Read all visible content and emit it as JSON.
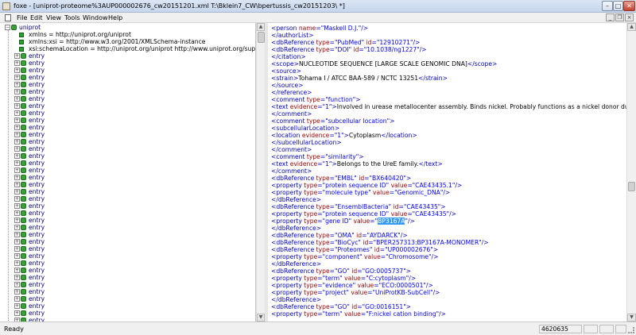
{
  "window": {
    "title": "foxe - [uniprot-proteome%3AUP000002676_cw20151201.xml  T:\\Bklein7_CW\\bpertussis_cw20151203\\ *]",
    "buttons": {
      "minimize": "–",
      "maximize": "□",
      "close": "✕"
    }
  },
  "menu": {
    "items": [
      "File",
      "Edit",
      "View",
      "Tools",
      "Window",
      "Help"
    ],
    "mdi": {
      "minimize": "_",
      "restore": "❐",
      "close": "×"
    }
  },
  "tree": {
    "root": "uniprot",
    "attributes": [
      "xmlns = http://uniprot.org/uniprot",
      "xmlns:xsi = http://www.w3.org/2001/XMLSchema-instance",
      "xsi:schemaLocation = http://uniprot.org/uniprot http://www.uniprot.org/suppor"
    ],
    "entry_label": "entry",
    "entry_count": 40
  },
  "xml_lines": [
    [
      [
        "t",
        "<person "
      ],
      [
        "a",
        "name"
      ],
      [
        "t",
        "=\""
      ],
      [
        "v",
        "Maskell D.J."
      ],
      [
        "t",
        "\"/>"
      ]
    ],
    [
      [
        "t",
        "</authorList>"
      ]
    ],
    [
      [
        "t",
        "<dbReference "
      ],
      [
        "a",
        "type"
      ],
      [
        "t",
        "=\""
      ],
      [
        "v",
        "PubMed"
      ],
      [
        "t",
        "\" "
      ],
      [
        "a",
        "id"
      ],
      [
        "t",
        "=\""
      ],
      [
        "v",
        "12910271"
      ],
      [
        "t",
        "\"/>"
      ]
    ],
    [
      [
        "t",
        "<dbReference "
      ],
      [
        "a",
        "type"
      ],
      [
        "t",
        "=\""
      ],
      [
        "v",
        "DOI"
      ],
      [
        "t",
        "\" "
      ],
      [
        "a",
        "id"
      ],
      [
        "t",
        "=\""
      ],
      [
        "v",
        "10.1038/ng1227"
      ],
      [
        "t",
        "\"/>"
      ]
    ],
    [
      [
        "t",
        "</citation>"
      ]
    ],
    [
      [
        "t",
        "<scope>"
      ],
      [
        "tx",
        "NUCLEOTIDE SEQUENCE [LARGE SCALE GENOMIC DNA]"
      ],
      [
        "t",
        "</scope>"
      ]
    ],
    [
      [
        "t",
        "<source>"
      ]
    ],
    [
      [
        "t",
        "<strain>"
      ],
      [
        "tx",
        "Tohama I / ATCC BAA-589 / NCTC 13251"
      ],
      [
        "t",
        "</strain>"
      ]
    ],
    [
      [
        "t",
        "</source>"
      ]
    ],
    [
      [
        "t",
        "</reference>"
      ]
    ],
    [
      [
        "t",
        "<comment "
      ],
      [
        "a",
        "type"
      ],
      [
        "t",
        "=\""
      ],
      [
        "v",
        "function"
      ],
      [
        "t",
        "\">"
      ]
    ],
    [
      [
        "t",
        "<text "
      ],
      [
        "a",
        "evidence"
      ],
      [
        "t",
        "=\""
      ],
      [
        "v",
        "1"
      ],
      [
        "t",
        "\">"
      ],
      [
        "tx",
        "Involved in urease metallocenter assembly. Binds nickel. Probably functions as a nickel donor during metal"
      ]
    ],
    [
      [
        "t",
        "</comment>"
      ]
    ],
    [
      [
        "t",
        "<comment "
      ],
      [
        "a",
        "type"
      ],
      [
        "t",
        "=\""
      ],
      [
        "v",
        "subcellular location"
      ],
      [
        "t",
        "\">"
      ]
    ],
    [
      [
        "t",
        "<subcellularLocation>"
      ]
    ],
    [
      [
        "t",
        "<location "
      ],
      [
        "a",
        "evidence"
      ],
      [
        "t",
        "=\""
      ],
      [
        "v",
        "1"
      ],
      [
        "t",
        "\">"
      ],
      [
        "tx",
        "Cytoplasm"
      ],
      [
        "t",
        "</location>"
      ]
    ],
    [
      [
        "t",
        "</subcellularLocation>"
      ]
    ],
    [
      [
        "t",
        "</comment>"
      ]
    ],
    [
      [
        "t",
        "<comment "
      ],
      [
        "a",
        "type"
      ],
      [
        "t",
        "=\""
      ],
      [
        "v",
        "similarity"
      ],
      [
        "t",
        "\">"
      ]
    ],
    [
      [
        "t",
        "<text "
      ],
      [
        "a",
        "evidence"
      ],
      [
        "t",
        "=\""
      ],
      [
        "v",
        "1"
      ],
      [
        "t",
        "\">"
      ],
      [
        "tx",
        "Belongs to the UreE family."
      ],
      [
        "t",
        "</text>"
      ]
    ],
    [
      [
        "t",
        "</comment>"
      ]
    ],
    [
      [
        "t",
        "<dbReference "
      ],
      [
        "a",
        "type"
      ],
      [
        "t",
        "=\""
      ],
      [
        "v",
        "EMBL"
      ],
      [
        "t",
        "\" "
      ],
      [
        "a",
        "id"
      ],
      [
        "t",
        "=\""
      ],
      [
        "v",
        "BX640420"
      ],
      [
        "t",
        "\">"
      ]
    ],
    [
      [
        "t",
        "<property "
      ],
      [
        "a",
        "type"
      ],
      [
        "t",
        "=\""
      ],
      [
        "v",
        "protein sequence ID"
      ],
      [
        "t",
        "\" "
      ],
      [
        "a",
        "value"
      ],
      [
        "t",
        "=\""
      ],
      [
        "v",
        "CAE43435.1"
      ],
      [
        "t",
        "\"/>"
      ]
    ],
    [
      [
        "t",
        "<property "
      ],
      [
        "a",
        "type"
      ],
      [
        "t",
        "=\""
      ],
      [
        "v",
        "molecule type"
      ],
      [
        "t",
        "\" "
      ],
      [
        "a",
        "value"
      ],
      [
        "t",
        "=\""
      ],
      [
        "v",
        "Genomic_DNA"
      ],
      [
        "t",
        "\"/>"
      ]
    ],
    [
      [
        "t",
        "</dbReference>"
      ]
    ],
    [
      [
        "t",
        "<dbReference "
      ],
      [
        "a",
        "type"
      ],
      [
        "t",
        "=\""
      ],
      [
        "v",
        "EnsemblBacteria"
      ],
      [
        "t",
        "\" "
      ],
      [
        "a",
        "id"
      ],
      [
        "t",
        "=\""
      ],
      [
        "v",
        "CAE43435"
      ],
      [
        "t",
        "\">"
      ]
    ],
    [
      [
        "t",
        "<property "
      ],
      [
        "a",
        "type"
      ],
      [
        "t",
        "=\""
      ],
      [
        "v",
        "protein sequence ID"
      ],
      [
        "t",
        "\" "
      ],
      [
        "a",
        "value"
      ],
      [
        "t",
        "=\""
      ],
      [
        "v",
        "CAE43435"
      ],
      [
        "t",
        "\"/>"
      ]
    ],
    [
      [
        "t",
        "<property "
      ],
      [
        "a",
        "type"
      ],
      [
        "t",
        "=\""
      ],
      [
        "v",
        "gene ID"
      ],
      [
        "t",
        "\" "
      ],
      [
        "a",
        "value"
      ],
      [
        "t",
        "=\""
      ],
      [
        "s",
        "BP3167A"
      ],
      [
        "t",
        "\"/>"
      ]
    ],
    [
      [
        "t",
        "</dbReference>"
      ]
    ],
    [
      [
        "t",
        "<dbReference "
      ],
      [
        "a",
        "type"
      ],
      [
        "t",
        "=\""
      ],
      [
        "v",
        "OMA"
      ],
      [
        "t",
        "\" "
      ],
      [
        "a",
        "id"
      ],
      [
        "t",
        "=\""
      ],
      [
        "v",
        "AYDARCK"
      ],
      [
        "t",
        "\"/>"
      ]
    ],
    [
      [
        "t",
        "<dbReference "
      ],
      [
        "a",
        "type"
      ],
      [
        "t",
        "=\""
      ],
      [
        "v",
        "BioCyc"
      ],
      [
        "t",
        "\" "
      ],
      [
        "a",
        "id"
      ],
      [
        "t",
        "=\""
      ],
      [
        "v",
        "BPER257313:BP3167A-MONOMER"
      ],
      [
        "t",
        "\"/>"
      ]
    ],
    [
      [
        "t",
        "<dbReference "
      ],
      [
        "a",
        "type"
      ],
      [
        "t",
        "=\""
      ],
      [
        "v",
        "Proteomes"
      ],
      [
        "t",
        "\" "
      ],
      [
        "a",
        "id"
      ],
      [
        "t",
        "=\""
      ],
      [
        "v",
        "UP000002676"
      ],
      [
        "t",
        "\">"
      ]
    ],
    [
      [
        "t",
        "<property "
      ],
      [
        "a",
        "type"
      ],
      [
        "t",
        "=\""
      ],
      [
        "v",
        "component"
      ],
      [
        "t",
        "\" "
      ],
      [
        "a",
        "value"
      ],
      [
        "t",
        "=\""
      ],
      [
        "v",
        "Chromosome"
      ],
      [
        "t",
        "\"/>"
      ]
    ],
    [
      [
        "t",
        "</dbReference>"
      ]
    ],
    [
      [
        "t",
        "<dbReference "
      ],
      [
        "a",
        "type"
      ],
      [
        "t",
        "=\""
      ],
      [
        "v",
        "GO"
      ],
      [
        "t",
        "\" "
      ],
      [
        "a",
        "id"
      ],
      [
        "t",
        "=\""
      ],
      [
        "v",
        "GO:0005737"
      ],
      [
        "t",
        "\">"
      ]
    ],
    [
      [
        "t",
        "<property "
      ],
      [
        "a",
        "type"
      ],
      [
        "t",
        "=\""
      ],
      [
        "v",
        "term"
      ],
      [
        "t",
        "\" "
      ],
      [
        "a",
        "value"
      ],
      [
        "t",
        "=\""
      ],
      [
        "v",
        "C:cytoplasm"
      ],
      [
        "t",
        "\"/>"
      ]
    ],
    [
      [
        "t",
        "<property "
      ],
      [
        "a",
        "type"
      ],
      [
        "t",
        "=\""
      ],
      [
        "v",
        "evidence"
      ],
      [
        "t",
        "\" "
      ],
      [
        "a",
        "value"
      ],
      [
        "t",
        "=\""
      ],
      [
        "v",
        "ECO:0000501"
      ],
      [
        "t",
        "\"/>"
      ]
    ],
    [
      [
        "t",
        "<property "
      ],
      [
        "a",
        "type"
      ],
      [
        "t",
        "=\""
      ],
      [
        "v",
        "project"
      ],
      [
        "t",
        "\" "
      ],
      [
        "a",
        "value"
      ],
      [
        "t",
        "=\""
      ],
      [
        "v",
        "UniProtKB-SubCell"
      ],
      [
        "t",
        "\"/>"
      ]
    ],
    [
      [
        "t",
        "</dbReference>"
      ]
    ],
    [
      [
        "t",
        "<dbReference "
      ],
      [
        "a",
        "type"
      ],
      [
        "t",
        "=\""
      ],
      [
        "v",
        "GO"
      ],
      [
        "t",
        "\" "
      ],
      [
        "a",
        "id"
      ],
      [
        "t",
        "=\""
      ],
      [
        "v",
        "GO:0016151"
      ],
      [
        "t",
        "\">"
      ]
    ],
    [
      [
        "t",
        "<property "
      ],
      [
        "a",
        "type"
      ],
      [
        "t",
        "=\""
      ],
      [
        "v",
        "term"
      ],
      [
        "t",
        "\" "
      ],
      [
        "a",
        "value"
      ],
      [
        "t",
        "=\""
      ],
      [
        "v",
        "F:nickel cation binding"
      ],
      [
        "t",
        "\"/>"
      ]
    ]
  ],
  "status": {
    "text": "Ready",
    "position": "4620635"
  }
}
